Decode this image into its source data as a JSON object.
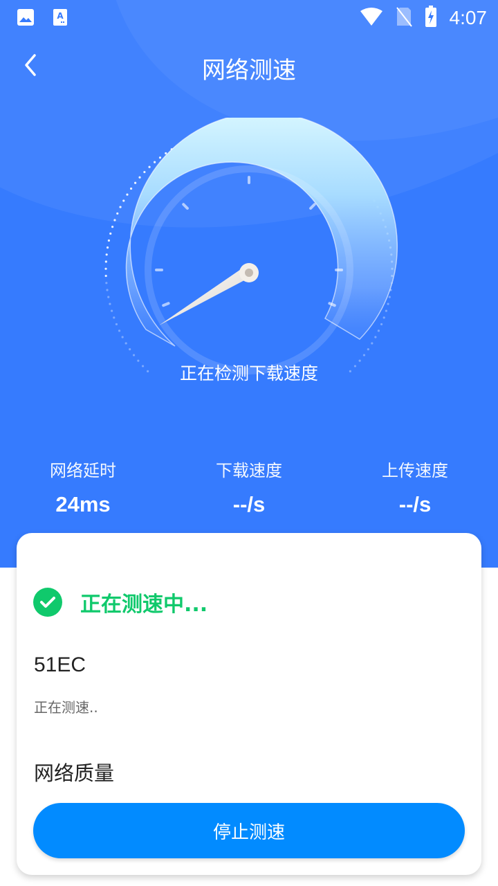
{
  "status_bar": {
    "time": "4:07",
    "left_icons": [
      "gallery-icon",
      "font-app-icon"
    ],
    "right_icons": [
      "wifi-icon",
      "no-sim-icon",
      "battery-charging-icon"
    ]
  },
  "header": {
    "back_icon": "chevron-left-icon",
    "title": "网络测速"
  },
  "gauge": {
    "caption": "正在检测下载速度",
    "needle_value_fraction": 0.0
  },
  "stats": [
    {
      "label": "网络延时",
      "value": "24ms"
    },
    {
      "label": "下载速度",
      "value": "--/s"
    },
    {
      "label": "上传速度",
      "value": "--/s"
    }
  ],
  "card": {
    "status_icon": "check-circle-icon",
    "status_text": "正在测速中...",
    "ssid": "51EC",
    "ssid_status": "正在测速..",
    "quality_label": "网络质量",
    "stop_button": "停止测速"
  },
  "colors": {
    "primary_blue": "#367bfe",
    "button_blue": "#028bff",
    "success_green": "#10c96c"
  }
}
